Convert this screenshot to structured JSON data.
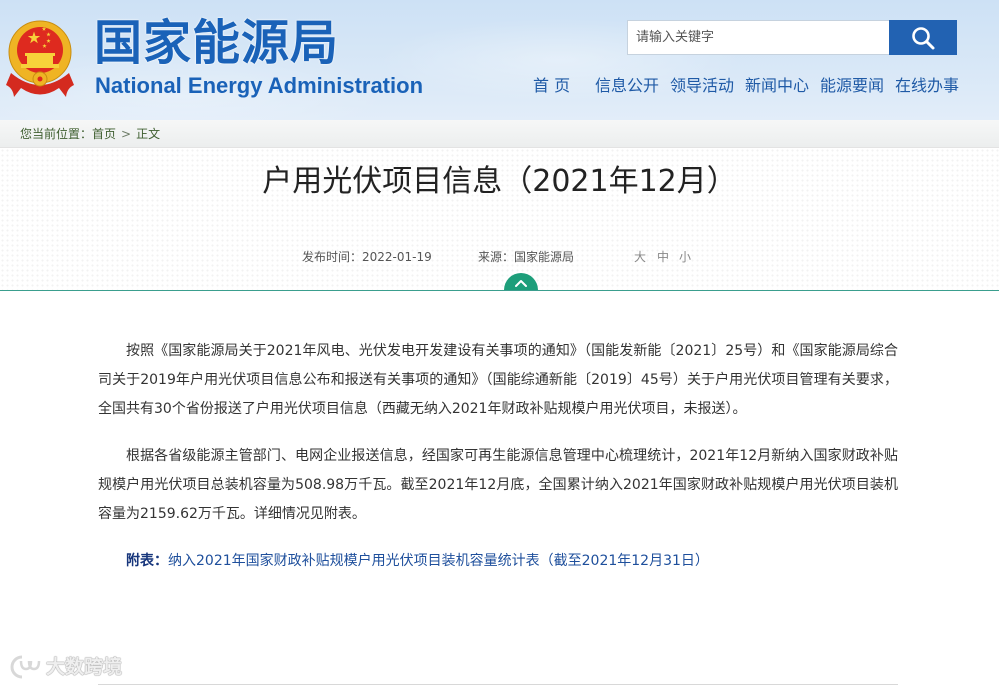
{
  "header": {
    "site_title_cn": "国家能源局",
    "site_title_en": "National Energy Administration",
    "search": {
      "placeholder": "请输入关键字"
    },
    "nav": [
      {
        "label": "首 页"
      },
      {
        "label": "信息公开"
      },
      {
        "label": "领导活动"
      },
      {
        "label": "新闻中心"
      },
      {
        "label": "能源要闻"
      },
      {
        "label": "在线办事"
      }
    ]
  },
  "breadcrumb": {
    "prefix": "您当前位置：",
    "home": "首页",
    "separator": ">",
    "current": "正文"
  },
  "article": {
    "title": "户用光伏项目信息（2021年12月）",
    "meta": {
      "publish_label": "发布时间：",
      "publish_date": "2022-01-19",
      "source_label": "来源：",
      "source": "国家能源局",
      "font_size_options": [
        "大",
        "中",
        "小"
      ]
    },
    "paragraphs": [
      "按照《国家能源局关于2021年风电、光伏发电开发建设有关事项的通知》（国能发新能〔2021〕25号）和《国家能源局综合司关于2019年户用光伏项目信息公布和报送有关事项的通知》（国能综通新能〔2019〕45号）关于户用光伏项目管理有关要求，全国共有30个省份报送了户用光伏项目信息（西藏无纳入2021年财政补贴规模户用光伏项目，未报送）。",
      "根据各省级能源主管部门、电网企业报送信息，经国家可再生能源信息管理中心梳理统计，2021年12月新纳入国家财政补贴规模户用光伏项目总装机容量为508.98万千瓦。截至2021年12月底，全国累计纳入2021年国家财政补贴规模户用光伏项目装机容量为2159.62万千瓦。详细情况见附表。"
    ],
    "attachment": {
      "label": "附表：",
      "link_text": "纳入2021年国家财政补贴规模户用光伏项目装机容量统计表（截至2021年12月31日）"
    }
  },
  "watermark": {
    "text": "大数跨境"
  },
  "icons": {
    "emblem": "national-emblem-icon",
    "search": "search-icon",
    "breadcrumb_separator": "chevron-right-icon",
    "toggle": "chevron-up-icon",
    "watermark_logo": "watermark-logo-icon"
  },
  "colors": {
    "brand_blue": "#1a62b8",
    "nav_blue": "#1f5aa6",
    "search_button": "#2262b2",
    "breadcrumb_text": "#3e5e2f",
    "divider_teal": "#3a9e8e",
    "toggle_green": "#1d9e7a",
    "attach_label": "#17367c",
    "link_blue": "#1e4f9c",
    "text": "#333333"
  }
}
